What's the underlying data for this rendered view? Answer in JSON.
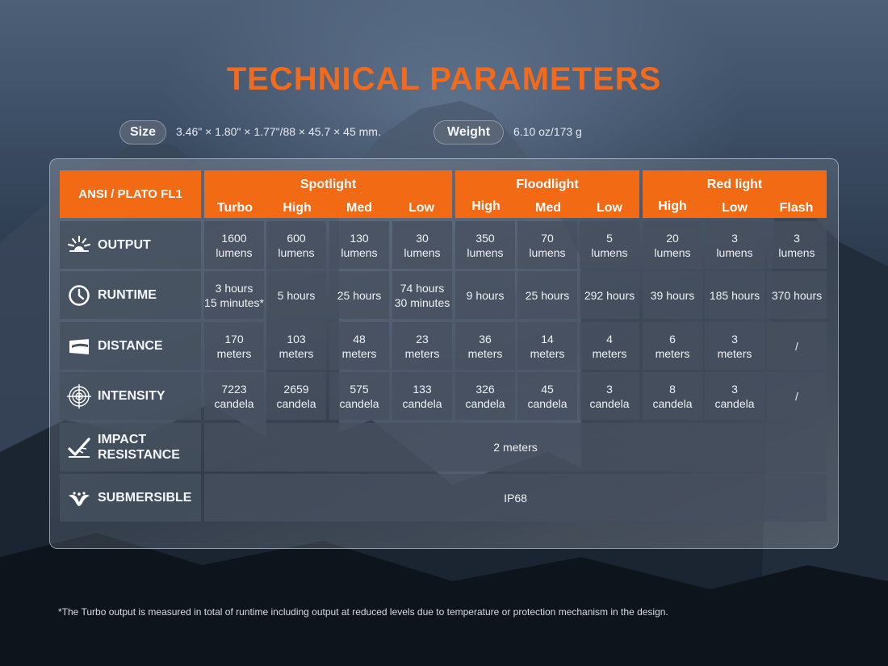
{
  "title": "TECHNICAL PARAMETERS",
  "specs": {
    "size_label": "Size",
    "size_value": "3.46\" × 1.80\" × 1.77\"/88 × 45.7 × 45 mm.",
    "weight_label": "Weight",
    "weight_value": "6.10 oz/173 g"
  },
  "table": {
    "corner_label": "ANSI / PLATO FL1",
    "groups": [
      {
        "name": "Spotlight",
        "modes": [
          "Turbo",
          "High",
          "Med",
          "Low"
        ]
      },
      {
        "name": "Floodlight",
        "modes": [
          "High",
          "Med",
          "Low"
        ]
      },
      {
        "name": "Red light",
        "modes": [
          "High",
          "Low",
          "Flash"
        ]
      }
    ],
    "rows": [
      {
        "label": "OUTPUT",
        "icon": "sunburst-icon",
        "cells": [
          [
            "1600",
            "lumens"
          ],
          [
            "600",
            "lumens"
          ],
          [
            "130",
            "lumens"
          ],
          [
            "30",
            "lumens"
          ],
          [
            "350",
            "lumens"
          ],
          [
            "70",
            "lumens"
          ],
          [
            "5",
            "lumens"
          ],
          [
            "20",
            "lumens"
          ],
          [
            "3",
            "lumens"
          ],
          [
            "3",
            "lumens"
          ]
        ]
      },
      {
        "label": "RUNTIME",
        "icon": "clock-icon",
        "cells": [
          [
            "3 hours",
            "15 minutes*"
          ],
          [
            "5 hours",
            ""
          ],
          [
            "25 hours",
            ""
          ],
          [
            "74 hours",
            "30 minutes"
          ],
          [
            "9 hours",
            ""
          ],
          [
            "25 hours",
            ""
          ],
          [
            "292 hours",
            ""
          ],
          [
            "39 hours",
            ""
          ],
          [
            "185 hours",
            ""
          ],
          [
            "370 hours",
            ""
          ]
        ]
      },
      {
        "label": "DISTANCE",
        "icon": "beam-distance-icon",
        "cells": [
          [
            "170",
            "meters"
          ],
          [
            "103",
            "meters"
          ],
          [
            "48",
            "meters"
          ],
          [
            "23",
            "meters"
          ],
          [
            "36",
            "meters"
          ],
          [
            "14",
            "meters"
          ],
          [
            "4",
            "meters"
          ],
          [
            "6",
            "meters"
          ],
          [
            "3",
            "meters"
          ],
          [
            "/",
            ""
          ]
        ]
      },
      {
        "label": "INTENSITY",
        "icon": "target-icon",
        "cells": [
          [
            "7223",
            "candela"
          ],
          [
            "2659",
            "candela"
          ],
          [
            "575",
            "candela"
          ],
          [
            "133",
            "candela"
          ],
          [
            "326",
            "candela"
          ],
          [
            "45",
            "candela"
          ],
          [
            "3",
            "candela"
          ],
          [
            "8",
            "candela"
          ],
          [
            "3",
            "candela"
          ],
          [
            "/",
            ""
          ]
        ]
      }
    ],
    "impact": {
      "label_line1": "IMPACT",
      "label_line2": "RESISTANCE",
      "icon": "impact-check-icon",
      "value": "2 meters"
    },
    "submersible": {
      "label": "SUBMERSIBLE",
      "icon": "water-splash-icon",
      "value": "IP68"
    }
  },
  "footnote": "*The Turbo output is measured in total of runtime including output at reduced levels due to temperature or protection mechanism in the design.",
  "colors": {
    "accent": "#f26a14",
    "title": "#f26a1b"
  }
}
